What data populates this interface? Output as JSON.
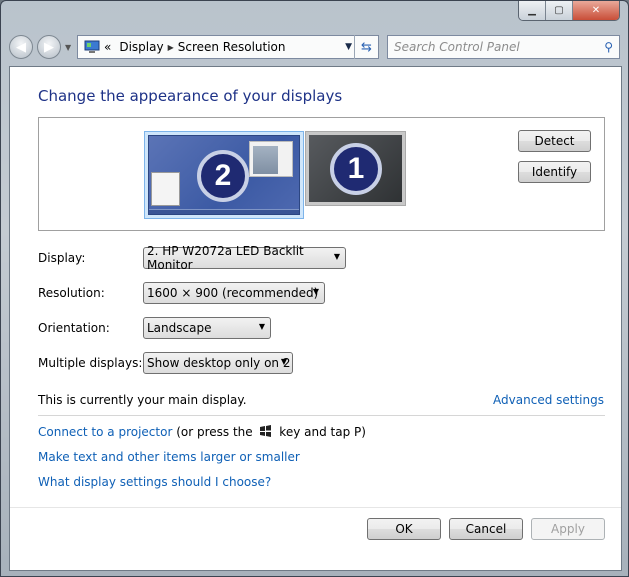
{
  "window": {
    "caption_buttons": {
      "minimize": "minimize",
      "maximize": "maximize",
      "close": "close"
    }
  },
  "navbar": {
    "back_icon": "back-arrow-icon",
    "forward_icon": "forward-arrow-icon",
    "history_icon": "chevron-down-icon",
    "address": {
      "overflow": "«",
      "crumbs": [
        "Display",
        "Screen Resolution"
      ],
      "separator": "▶",
      "dropdown": "▼"
    },
    "refresh_glyph": "⇆",
    "search": {
      "placeholder": "Search Control Panel",
      "icon": "🔍"
    }
  },
  "main": {
    "title": "Change the appearance of your displays",
    "monitors": [
      {
        "number": "2",
        "selected": true
      },
      {
        "number": "1",
        "selected": false
      }
    ],
    "detect_label": "Detect",
    "identify_label": "Identify",
    "fields": {
      "display": {
        "label": "Display:",
        "value": "2. HP W2072a LED Backlit Monitor"
      },
      "resolution": {
        "label": "Resolution:",
        "value": "1600 × 900 (recommended)"
      },
      "orientation": {
        "label": "Orientation:",
        "value": "Landscape"
      },
      "multiple": {
        "label": "Multiple displays:",
        "value": "Show desktop only on 2"
      }
    },
    "dropdown_arrow": "▼",
    "main_display_text": "This is currently your main display.",
    "advanced_settings": "Advanced settings",
    "projector_link": "Connect to a projector",
    "projector_hint_pre": " (or press the ",
    "projector_hint_post": " key and tap P)",
    "text_size_link": "Make text and other items larger or smaller",
    "help_link": "What display settings should I choose?"
  },
  "footer": {
    "ok": "OK",
    "cancel": "Cancel",
    "apply": "Apply"
  }
}
